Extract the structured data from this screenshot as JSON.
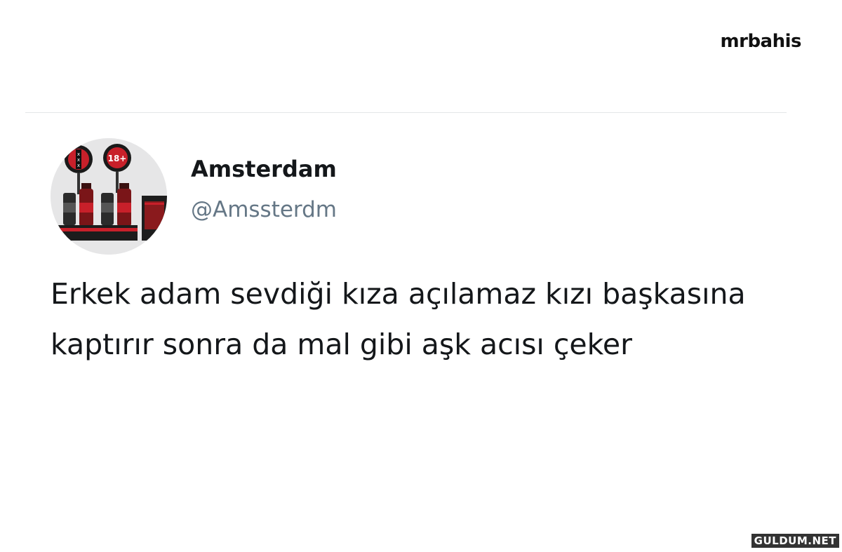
{
  "brand": {
    "label": "mrbahis"
  },
  "tweet": {
    "display_name": "Amsterdam",
    "handle": "@Amssterdm",
    "text": "Erkek adam sevdiği kıza açılamaz kızı başkasına kaptırır sonra da mal gibi aşk acısı çeker",
    "avatar_badge": "18+"
  },
  "watermark": {
    "label": "GULDUM.NET"
  },
  "colors": {
    "text": "#14171a",
    "handle": "#657786",
    "divider": "#e3e6e8",
    "avatar_red": "#c8202a"
  }
}
